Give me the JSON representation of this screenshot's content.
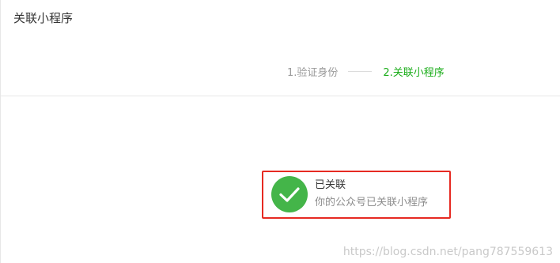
{
  "header": {
    "title": "关联小程序"
  },
  "steps": [
    {
      "label": "1.验证身份",
      "state": "done"
    },
    {
      "label": "2.关联小程序",
      "state": "current"
    }
  ],
  "result": {
    "icon": "check-circle-icon",
    "title": "已关联",
    "description": "你的公众号已关联小程序"
  },
  "watermark": "https://blog.csdn.net/pang787559613",
  "colors": {
    "accent": "#1aad19",
    "success": "#44b549",
    "highlight_border": "#e62a22"
  }
}
